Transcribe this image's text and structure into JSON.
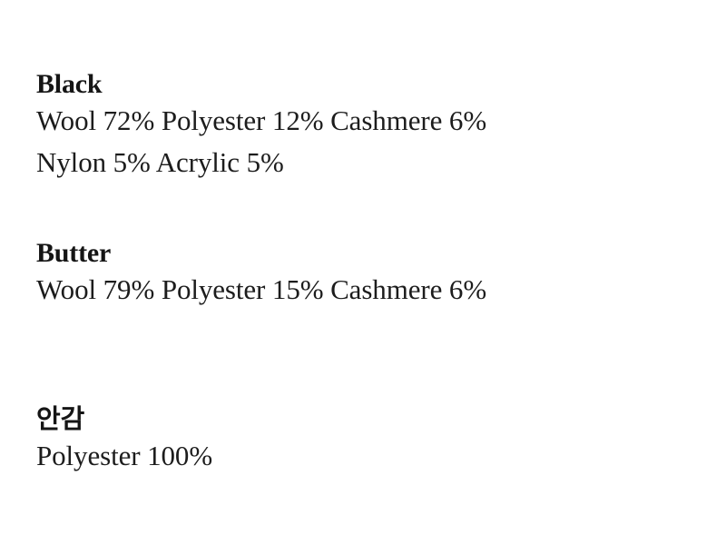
{
  "document": {
    "type": "fabric-composition-text",
    "background_color": "#ffffff",
    "text_color": "#1a1a1a",
    "blocks": [
      {
        "id": "black",
        "title": "Black",
        "title_script": "latin",
        "lines": [
          "Wool 72% Polyester 12% Cashmere 6%",
          "Nylon 5% Acrylic 5%"
        ],
        "materials": [
          {
            "name": "Wool",
            "percent": "72%"
          },
          {
            "name": "Polyester",
            "percent": "12%"
          },
          {
            "name": "Cashmere",
            "percent": "6%"
          },
          {
            "name": "Nylon",
            "percent": "5%"
          },
          {
            "name": "Acrylic",
            "percent": "5%"
          }
        ]
      },
      {
        "id": "butter",
        "title": "Butter",
        "title_script": "latin",
        "lines": [
          "Wool 79% Polyester 15% Cashmere 6%"
        ],
        "materials": [
          {
            "name": "Wool",
            "percent": "79%"
          },
          {
            "name": "Polyester",
            "percent": "15%"
          },
          {
            "name": "Cashmere",
            "percent": "6%"
          }
        ]
      },
      {
        "id": "lining",
        "title": "안감",
        "title_script": "hangul",
        "lines": [
          "Polyester 100%"
        ],
        "materials": [
          {
            "name": "Polyester",
            "percent": "100%"
          }
        ]
      }
    ]
  }
}
